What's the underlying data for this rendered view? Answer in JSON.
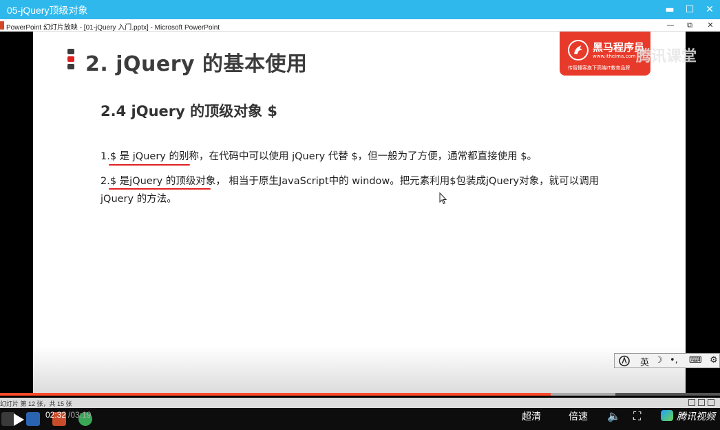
{
  "video_window": {
    "title": "05-jQuery顶级对象",
    "controls": {
      "minimize": "▬",
      "maximize": "☐",
      "close": "✕"
    }
  },
  "ppt_window": {
    "title": "PowerPoint 幻灯片放映 - [01-jQuery 入门.pptx] - Microsoft PowerPoint",
    "controls": {
      "minimize": "—",
      "restore": "⧉",
      "close": "✕"
    }
  },
  "slide": {
    "heading": "2. jQuery 的基本使用",
    "subheading": "2.4  jQuery 的顶级对象 $",
    "line1": "1.$ 是 jQuery 的别称，在代码中可以使用 jQuery 代替 $，但一般为了方便，通常都直接使用 $。",
    "line2": "2.$ 是jQuery 的顶级对象， 相当于原生JavaScript中的 window。把元素利用$包装成jQuery对象，就可以调用",
    "line3": "jQuery 的方法。",
    "accent_colors": [
      "#3c3c3c",
      "#e02020",
      "#3c3c3c"
    ]
  },
  "logo": {
    "name": "黑马程序员",
    "url": "www.itheima.com",
    "slogan": "传智播客旗下高端IT教育品牌",
    "watermark": "腾讯课堂",
    "color": "#e83a2a"
  },
  "ime": {
    "lang": "英",
    "moon": "☽",
    "punct": "•,",
    "keyboard": "⌨",
    "settings": "⚙"
  },
  "ppt_status": {
    "slide_info": "幻灯片 第 12 张，共 15 张"
  },
  "player": {
    "current_time": "02:32",
    "total_time": "/03:19",
    "progress": 0.765,
    "buffered": 0.855,
    "quality_label": "超清",
    "speed_label": "倍速",
    "brand": "腾讯视频",
    "volume_icon": "🔈",
    "fullscreen_icon": "⛶"
  }
}
